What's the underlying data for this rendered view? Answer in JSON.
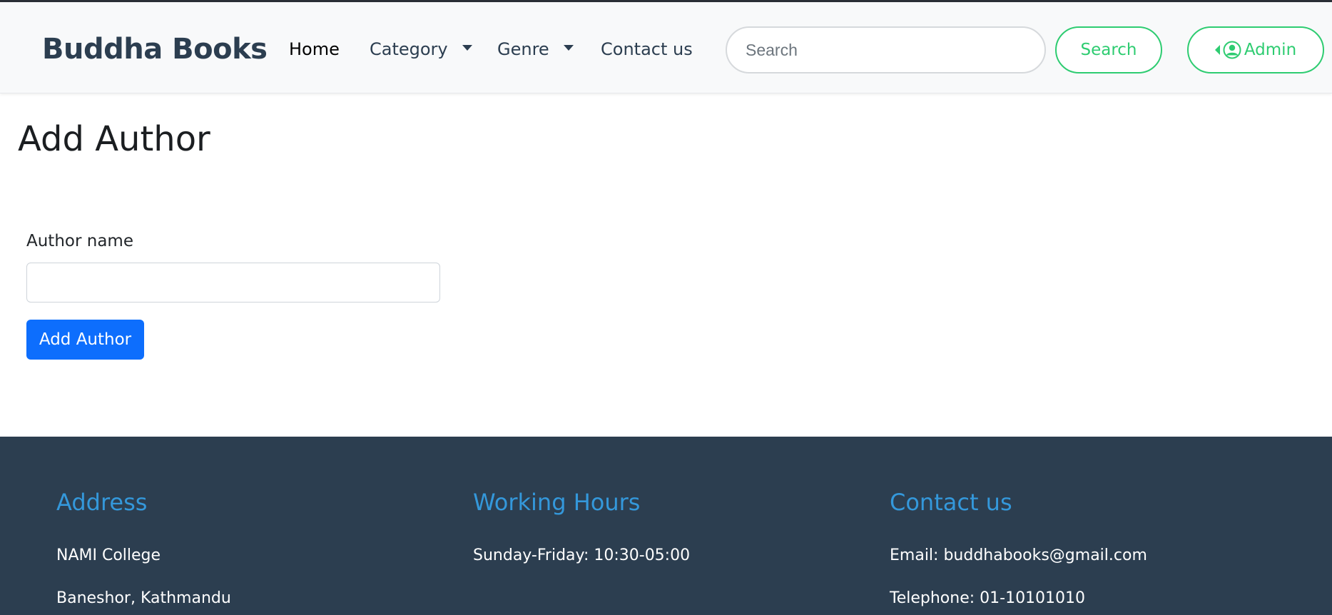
{
  "brand": {
    "name": "Buddha Books"
  },
  "nav": {
    "home": "Home",
    "category": "Category",
    "genre": "Genre",
    "contact": "Contact us"
  },
  "search": {
    "placeholder": "Search",
    "button_label": "Search"
  },
  "admin": {
    "label": "Admin"
  },
  "main": {
    "title": "Add Author",
    "author_label": "Author name",
    "author_value": "",
    "submit_label": "Add Author"
  },
  "footer": {
    "address": {
      "heading": "Address",
      "line1": "NAMI College",
      "line2": "Baneshor, Kathmandu"
    },
    "hours": {
      "heading": "Working Hours",
      "line1": "Sunday-Friday: 10:30-05:00"
    },
    "contact": {
      "heading": "Contact us",
      "email": "Email: buddhabooks@gmail.com",
      "phone": "Telephone: 01-10101010"
    }
  },
  "colors": {
    "brand_text": "#2c3e50",
    "accent_green": "#2ecc71",
    "primary_blue": "#0d6efd",
    "footer_bg": "#2c3e50",
    "footer_heading": "#3498db"
  },
  "icons": {
    "admin": "user-circle-icon",
    "admin_caret": "caret-left-icon",
    "dropdown": "caret-down-icon"
  }
}
